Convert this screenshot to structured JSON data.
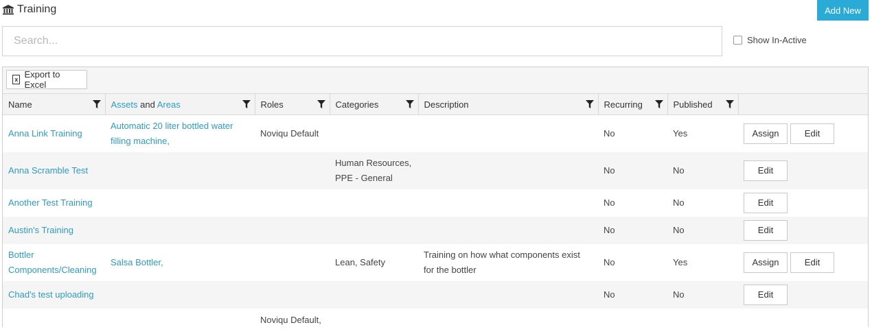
{
  "header": {
    "title": "Training",
    "add_new_label": "Add New"
  },
  "search": {
    "placeholder": "Search...",
    "value": ""
  },
  "inactive": {
    "label": "Show In-Active",
    "checked": false
  },
  "toolbar": {
    "export_label": "Export to Excel"
  },
  "columns": {
    "name": "Name",
    "assets": "Assets",
    "and": "and",
    "areas": "Areas",
    "roles": "Roles",
    "categories": "Categories",
    "description": "Description",
    "recurring": "Recurring",
    "published": "Published"
  },
  "buttons": {
    "assign": "Assign",
    "edit": "Edit"
  },
  "rows": [
    {
      "name": "Anna Link Training",
      "assets": "Automatic 20 liter bottled water filling machine,",
      "roles": "Noviqu Default",
      "categories": "",
      "description": "",
      "recurring": "No",
      "published": "Yes",
      "has_assign": true
    },
    {
      "name": "Anna Scramble Test",
      "assets": "",
      "roles": "",
      "categories": "Human Resources, PPE - General",
      "description": "",
      "recurring": "No",
      "published": "No",
      "has_assign": false
    },
    {
      "name": "Another Test Training",
      "assets": "",
      "roles": "",
      "categories": "",
      "description": "",
      "recurring": "No",
      "published": "No",
      "has_assign": false
    },
    {
      "name": "Austin's Training",
      "assets": "",
      "roles": "",
      "categories": "",
      "description": "",
      "recurring": "No",
      "published": "No",
      "has_assign": false
    },
    {
      "name": "Bottler Components/Cleaning",
      "assets": "Salsa Bottler,",
      "roles": "",
      "categories": "Lean, Safety",
      "description": "Training on how what components exist for the bottler",
      "recurring": "No",
      "published": "Yes",
      "has_assign": true
    },
    {
      "name": "Chad's test uploading",
      "assets": "",
      "roles": "",
      "categories": "",
      "description": "",
      "recurring": "No",
      "published": "No",
      "has_assign": false
    },
    {
      "name": "",
      "assets": "",
      "roles": "Noviqu Default,",
      "categories": "",
      "description": "",
      "recurring": "",
      "published": "",
      "has_assign": false
    }
  ]
}
